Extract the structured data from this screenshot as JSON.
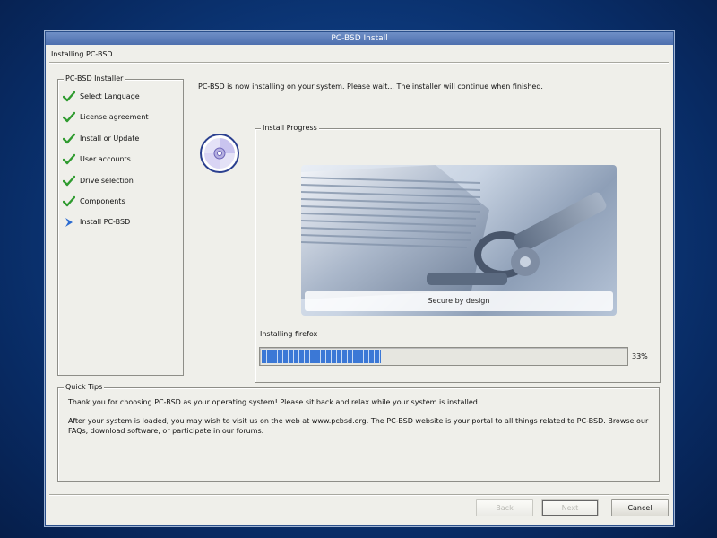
{
  "window": {
    "title": "PC-BSD Install",
    "subtitle": "Installing PC-BSD"
  },
  "sidebar": {
    "title": "PC-BSD Installer",
    "items": [
      {
        "label": "Select Language",
        "state": "done"
      },
      {
        "label": "License agreement",
        "state": "done"
      },
      {
        "label": "Install or Update",
        "state": "done"
      },
      {
        "label": "User accounts",
        "state": "done"
      },
      {
        "label": "Drive selection",
        "state": "done"
      },
      {
        "label": "Components",
        "state": "done"
      },
      {
        "label": "Install PC-BSD",
        "state": "current"
      }
    ]
  },
  "main": {
    "status_message": "PC-BSD is now installing on your system. Please wait... The installer will continue when finished.",
    "progress_group_title": "Install Progress",
    "banner_caption": "Secure by design",
    "current_task": "Installing firefox",
    "progress_percent": 33,
    "progress_label": "33%"
  },
  "tips": {
    "title": "Quick Tips",
    "line1": "Thank you for choosing PC-BSD as your operating system! Please sit back and relax while your system is installed.",
    "line2": "After your system is loaded, you may wish to visit us on the web at www.pcbsd.org. The PC-BSD website is your portal to all things related to PC-BSD. Browse our FAQs, download software, or participate in our forums."
  },
  "buttons": {
    "back": "Back",
    "next": "Next",
    "cancel": "Cancel"
  },
  "colors": {
    "accent": "#3b78d6",
    "check": "#2f9b2f",
    "current_arrow": "#2a6ad0"
  },
  "icons": {
    "done": "check-icon",
    "current": "arrow-right-icon",
    "disc": "cd-disc-icon"
  }
}
